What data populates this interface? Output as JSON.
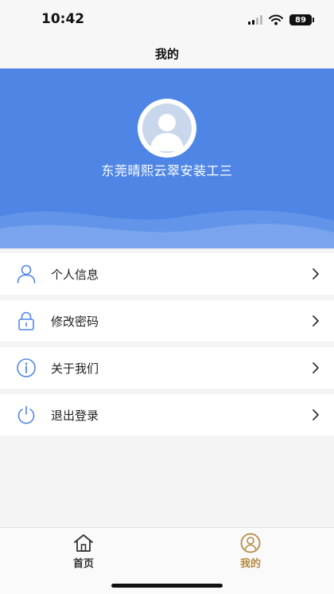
{
  "status_bar": {
    "time": "10:42",
    "battery": "89"
  },
  "nav": {
    "title": "我的"
  },
  "profile": {
    "name": "东莞晴熙云翠安装工三"
  },
  "menu": {
    "items": [
      {
        "label": "个人信息",
        "icon": "person-icon"
      },
      {
        "label": "修改密码",
        "icon": "lock-icon"
      },
      {
        "label": "关于我们",
        "icon": "info-icon"
      },
      {
        "label": "退出登录",
        "icon": "power-icon"
      }
    ]
  },
  "tab_bar": {
    "tabs": [
      {
        "label": "首页",
        "icon": "home-icon",
        "active": false
      },
      {
        "label": "我的",
        "icon": "profile-icon",
        "active": true
      }
    ]
  },
  "colors": {
    "primary": "#4f86e6",
    "active_tab": "#b88a44"
  }
}
